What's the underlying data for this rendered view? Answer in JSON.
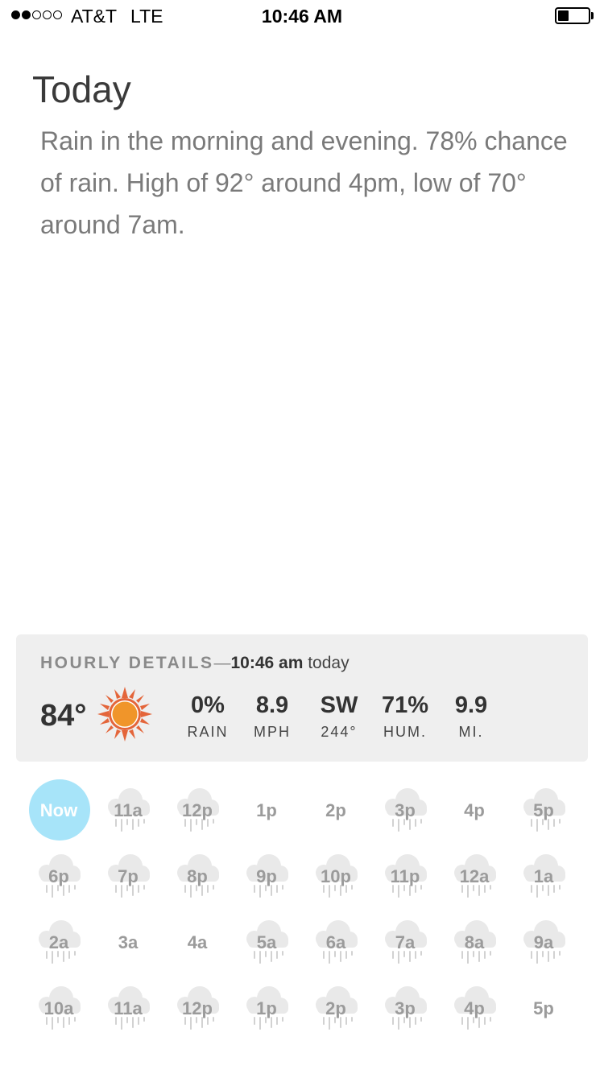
{
  "status_bar": {
    "signal_strength": 2,
    "signal_max": 5,
    "carrier": "AT&T",
    "network": "LTE",
    "time": "10:46 AM",
    "battery_level": 0.35
  },
  "summary": {
    "heading": "Today",
    "text": "Rain in the morning and evening. 78% chance of rain. High of 92° around 4pm, low of 70° around 7am."
  },
  "hourly_details": {
    "label": "HOURLY DETAILS",
    "dash": "—",
    "time": "10:46 am",
    "day": "today",
    "temperature": "84°",
    "condition_icon": "sun-icon",
    "stats": [
      {
        "value": "0%",
        "label": "RAIN"
      },
      {
        "value": "8.9",
        "label": "MPH"
      },
      {
        "value": "SW",
        "label": "244°"
      },
      {
        "value": "71%",
        "label": "HUM."
      },
      {
        "value": "9.9",
        "label": "MI."
      }
    ]
  },
  "hours": [
    {
      "label": "Now",
      "now": true,
      "rain": false
    },
    {
      "label": "11a",
      "rain": true
    },
    {
      "label": "12p",
      "rain": true
    },
    {
      "label": "1p",
      "rain": false
    },
    {
      "label": "2p",
      "rain": false
    },
    {
      "label": "3p",
      "rain": true
    },
    {
      "label": "4p",
      "rain": false
    },
    {
      "label": "5p",
      "rain": true
    },
    {
      "label": "6p",
      "rain": true
    },
    {
      "label": "7p",
      "rain": true
    },
    {
      "label": "8p",
      "rain": true
    },
    {
      "label": "9p",
      "rain": true
    },
    {
      "label": "10p",
      "rain": true
    },
    {
      "label": "11p",
      "rain": true
    },
    {
      "label": "12a",
      "rain": true
    },
    {
      "label": "1a",
      "rain": true
    },
    {
      "label": "2a",
      "rain": true
    },
    {
      "label": "3a",
      "rain": false
    },
    {
      "label": "4a",
      "rain": false
    },
    {
      "label": "5a",
      "rain": true
    },
    {
      "label": "6a",
      "rain": true
    },
    {
      "label": "7a",
      "rain": true
    },
    {
      "label": "8a",
      "rain": true
    },
    {
      "label": "9a",
      "rain": true
    },
    {
      "label": "10a",
      "rain": true
    },
    {
      "label": "11a",
      "rain": true
    },
    {
      "label": "12p",
      "rain": true
    },
    {
      "label": "1p",
      "rain": true
    },
    {
      "label": "2p",
      "rain": true
    },
    {
      "label": "3p",
      "rain": true
    },
    {
      "label": "4p",
      "rain": true
    },
    {
      "label": "5p",
      "rain": false
    }
  ],
  "colors": {
    "now_highlight": "#a7e4f9",
    "card_background": "#efefef",
    "sun_core": "#f0952a",
    "sun_rays": "#e4653a"
  }
}
